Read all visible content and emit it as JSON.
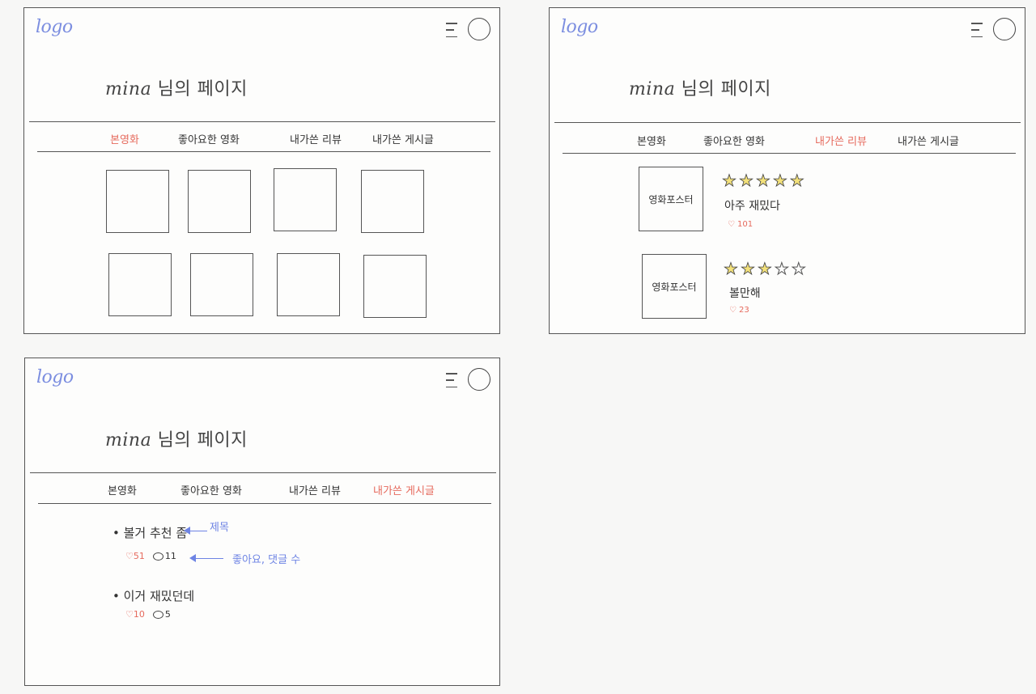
{
  "colors": {
    "accent": "#e66a5d",
    "logo": "#7c8ee0",
    "annotation": "#6e84e4",
    "star_fill": "#f3e17a"
  },
  "common": {
    "logo": "logo",
    "title_name": "mina",
    "title_suffix": " 님의 페이지",
    "menu_icon": "hamburger-menu-icon",
    "profile_icon": "profile-circle-icon"
  },
  "tabs": [
    "본영화",
    "좋아요한 영화",
    "내가쓴 리뷰",
    "내가쓴 게시글"
  ],
  "frame_watched": {
    "active_tab": 0
  },
  "frame_reviews": {
    "active_tab": 2,
    "reviews": [
      {
        "poster": "영화포스터",
        "rating": 5,
        "text": "아주 재밌다",
        "likes": "101"
      },
      {
        "poster": "영화포스터",
        "rating": 3,
        "text": "볼만해",
        "likes": "23"
      }
    ]
  },
  "frame_posts": {
    "active_tab": 3,
    "posts": [
      {
        "title": "볼거 추천 좀",
        "likes": "51",
        "comments": "11"
      },
      {
        "title": "이거 재밌던데",
        "likes": "10",
        "comments": "5"
      }
    ],
    "annotations": {
      "title_note": "제목",
      "meta_note": "좋아요, 댓글 수"
    }
  }
}
